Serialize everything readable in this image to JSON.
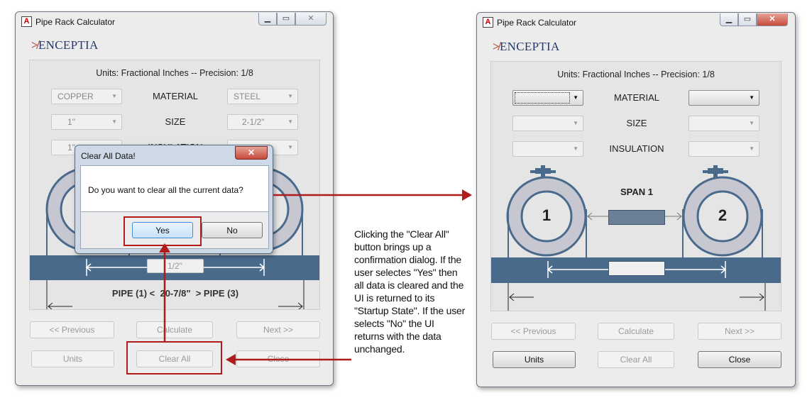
{
  "left_window": {
    "title": "Pipe Rack Calculator",
    "app_icon": "A",
    "logo": {
      "mark": "≯",
      "text": "ENCEPTIA"
    },
    "units_text": "Units: Fractional Inches -- Precision: 1/8",
    "material_label": "MATERIAL",
    "size_label": "SIZE",
    "insulation_label_partial": "INSULATION",
    "combo_left_material": "COPPER",
    "combo_left_size": "1\"",
    "combo_left_insulation_partial": "1\"",
    "combo_right_material": "STEEL",
    "combo_right_size": "2-1/2\"",
    "span_value": "1/2\"",
    "pipe_line": "PIPE (1) <  20-7/8\"  > PIPE (3)",
    "previous_label": "<< Previous",
    "calculate_label": "Calculate",
    "next_label": "Next >>",
    "units_label": "Units",
    "clear_all_label": "Clear All",
    "close_label": "Close"
  },
  "dialog": {
    "title": "Clear All Data!",
    "message": "Do you want to clear all the current data?",
    "yes_label": "Yes",
    "no_label": "No"
  },
  "annotation": "Clicking the \"Clear All\" button brings up a confirmation dialog. If the user selectes \"Yes\" then all data is cleared and the UI is returned to its \"Startup State\". If the user selects \"No\" the UI returns with the data unchanged.",
  "right_window": {
    "title": "Pipe Rack Calculator",
    "app_icon": "A",
    "logo": {
      "mark": "≯",
      "text": "ENCEPTIA"
    },
    "units_text": "Units: Fractional Inches -- Precision: 1/8",
    "material_label": "MATERIAL",
    "size_label": "SIZE",
    "insulation_label": "INSULATION",
    "span_label": "SPAN 1",
    "pipe1_number": "1",
    "pipe2_number": "2",
    "previous_label": "<< Previous",
    "calculate_label": "Calculate",
    "next_label": "Next >>",
    "units_label": "Units",
    "clear_all_label": "Clear All",
    "close_label": "Close"
  },
  "window_buttons": {
    "minimize": "minimize-icon",
    "maximize": "maximize-icon",
    "close": "close-icon"
  },
  "colors": {
    "rack_blue": "#4a6a8c",
    "pipe_gray": "#c7c7d2",
    "annotation_red": "#b01b1b",
    "dialog_close_red": "#c74a3b"
  }
}
